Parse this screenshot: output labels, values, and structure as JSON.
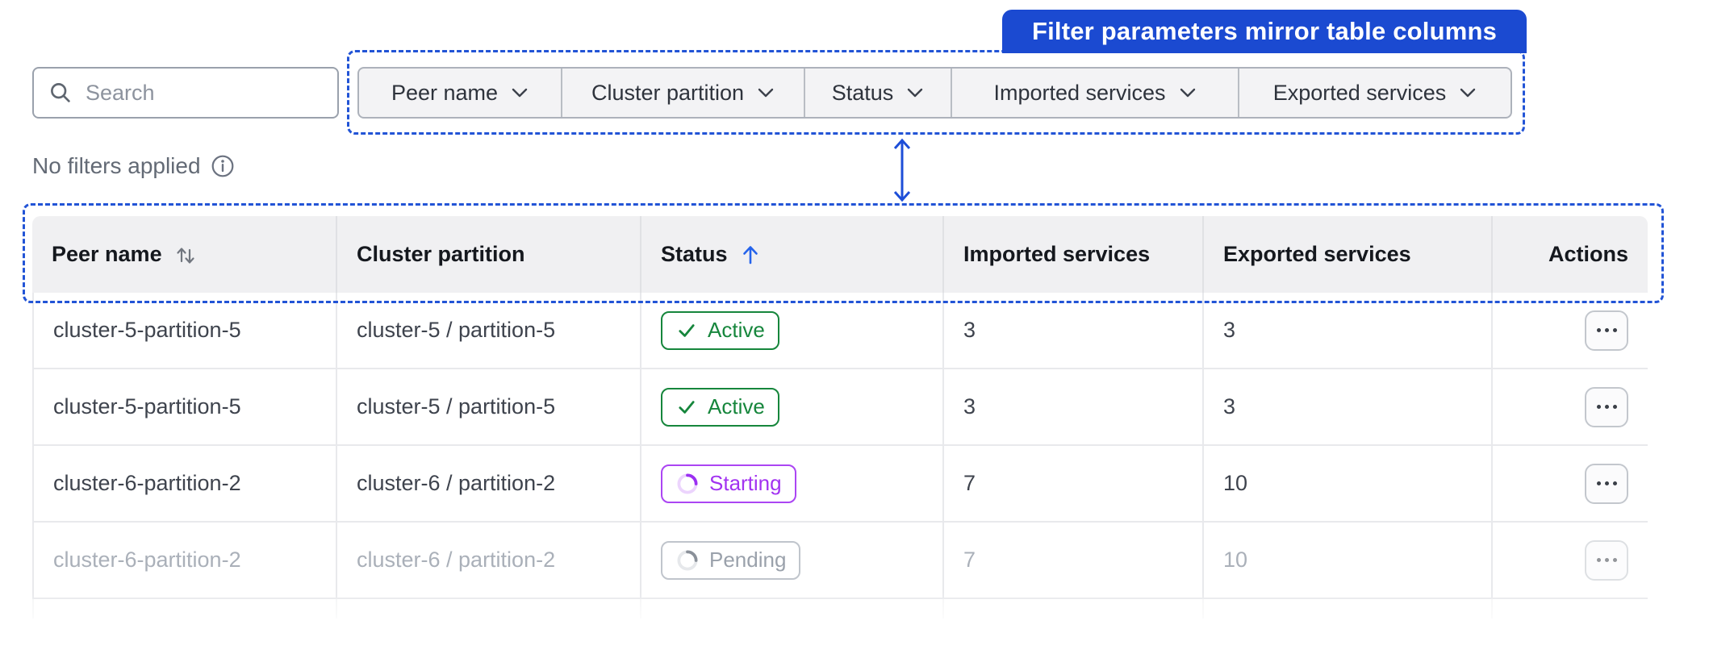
{
  "banner": {
    "label": "Filter parameters mirror table columns",
    "bg_color": "#1b4ad1",
    "text_color": "#ffffff"
  },
  "annotation": {
    "dash_color": "#2254d6",
    "arrow_color": "#1d4ed8"
  },
  "search": {
    "placeholder": "Search"
  },
  "filters": {
    "items": [
      {
        "label": "Peer name"
      },
      {
        "label": "Cluster partition"
      },
      {
        "label": "Status"
      },
      {
        "label": "Imported services"
      },
      {
        "label": "Exported services"
      }
    ]
  },
  "filter_status": {
    "text": "No filters applied"
  },
  "table": {
    "columns": [
      {
        "label": "Peer name",
        "sort": "both"
      },
      {
        "label": "Cluster partition",
        "sort": "none"
      },
      {
        "label": "Status",
        "sort": "asc"
      },
      {
        "label": "Imported services",
        "sort": "none"
      },
      {
        "label": "Exported services",
        "sort": "none"
      },
      {
        "label": "Actions",
        "sort": "none"
      }
    ],
    "rows": [
      {
        "peer_name": "cluster-5-partition-5",
        "cluster_partition": "cluster-5 / partition-5",
        "status": {
          "label": "Active",
          "kind": "active"
        },
        "imported_services": "3",
        "exported_services": "3",
        "muted": false
      },
      {
        "peer_name": "cluster-5-partition-5",
        "cluster_partition": "cluster-5 / partition-5",
        "status": {
          "label": "Active",
          "kind": "active"
        },
        "imported_services": "3",
        "exported_services": "3",
        "muted": false
      },
      {
        "peer_name": "cluster-6-partition-2",
        "cluster_partition": "cluster-6 / partition-2",
        "status": {
          "label": "Starting",
          "kind": "starting"
        },
        "imported_services": "7",
        "exported_services": "10",
        "muted": false
      },
      {
        "peer_name": "cluster-6-partition-2",
        "cluster_partition": "cluster-6 / partition-2",
        "status": {
          "label": "Pending",
          "kind": "pending"
        },
        "imported_services": "7",
        "exported_services": "10",
        "muted": true
      }
    ]
  },
  "colors": {
    "sort_arrow_blue": "#2563eb",
    "active_green": "#16863c",
    "starting_purple": "#a232f1",
    "pending_gray": "#6b7280",
    "header_bg": "#f0f0f2"
  }
}
